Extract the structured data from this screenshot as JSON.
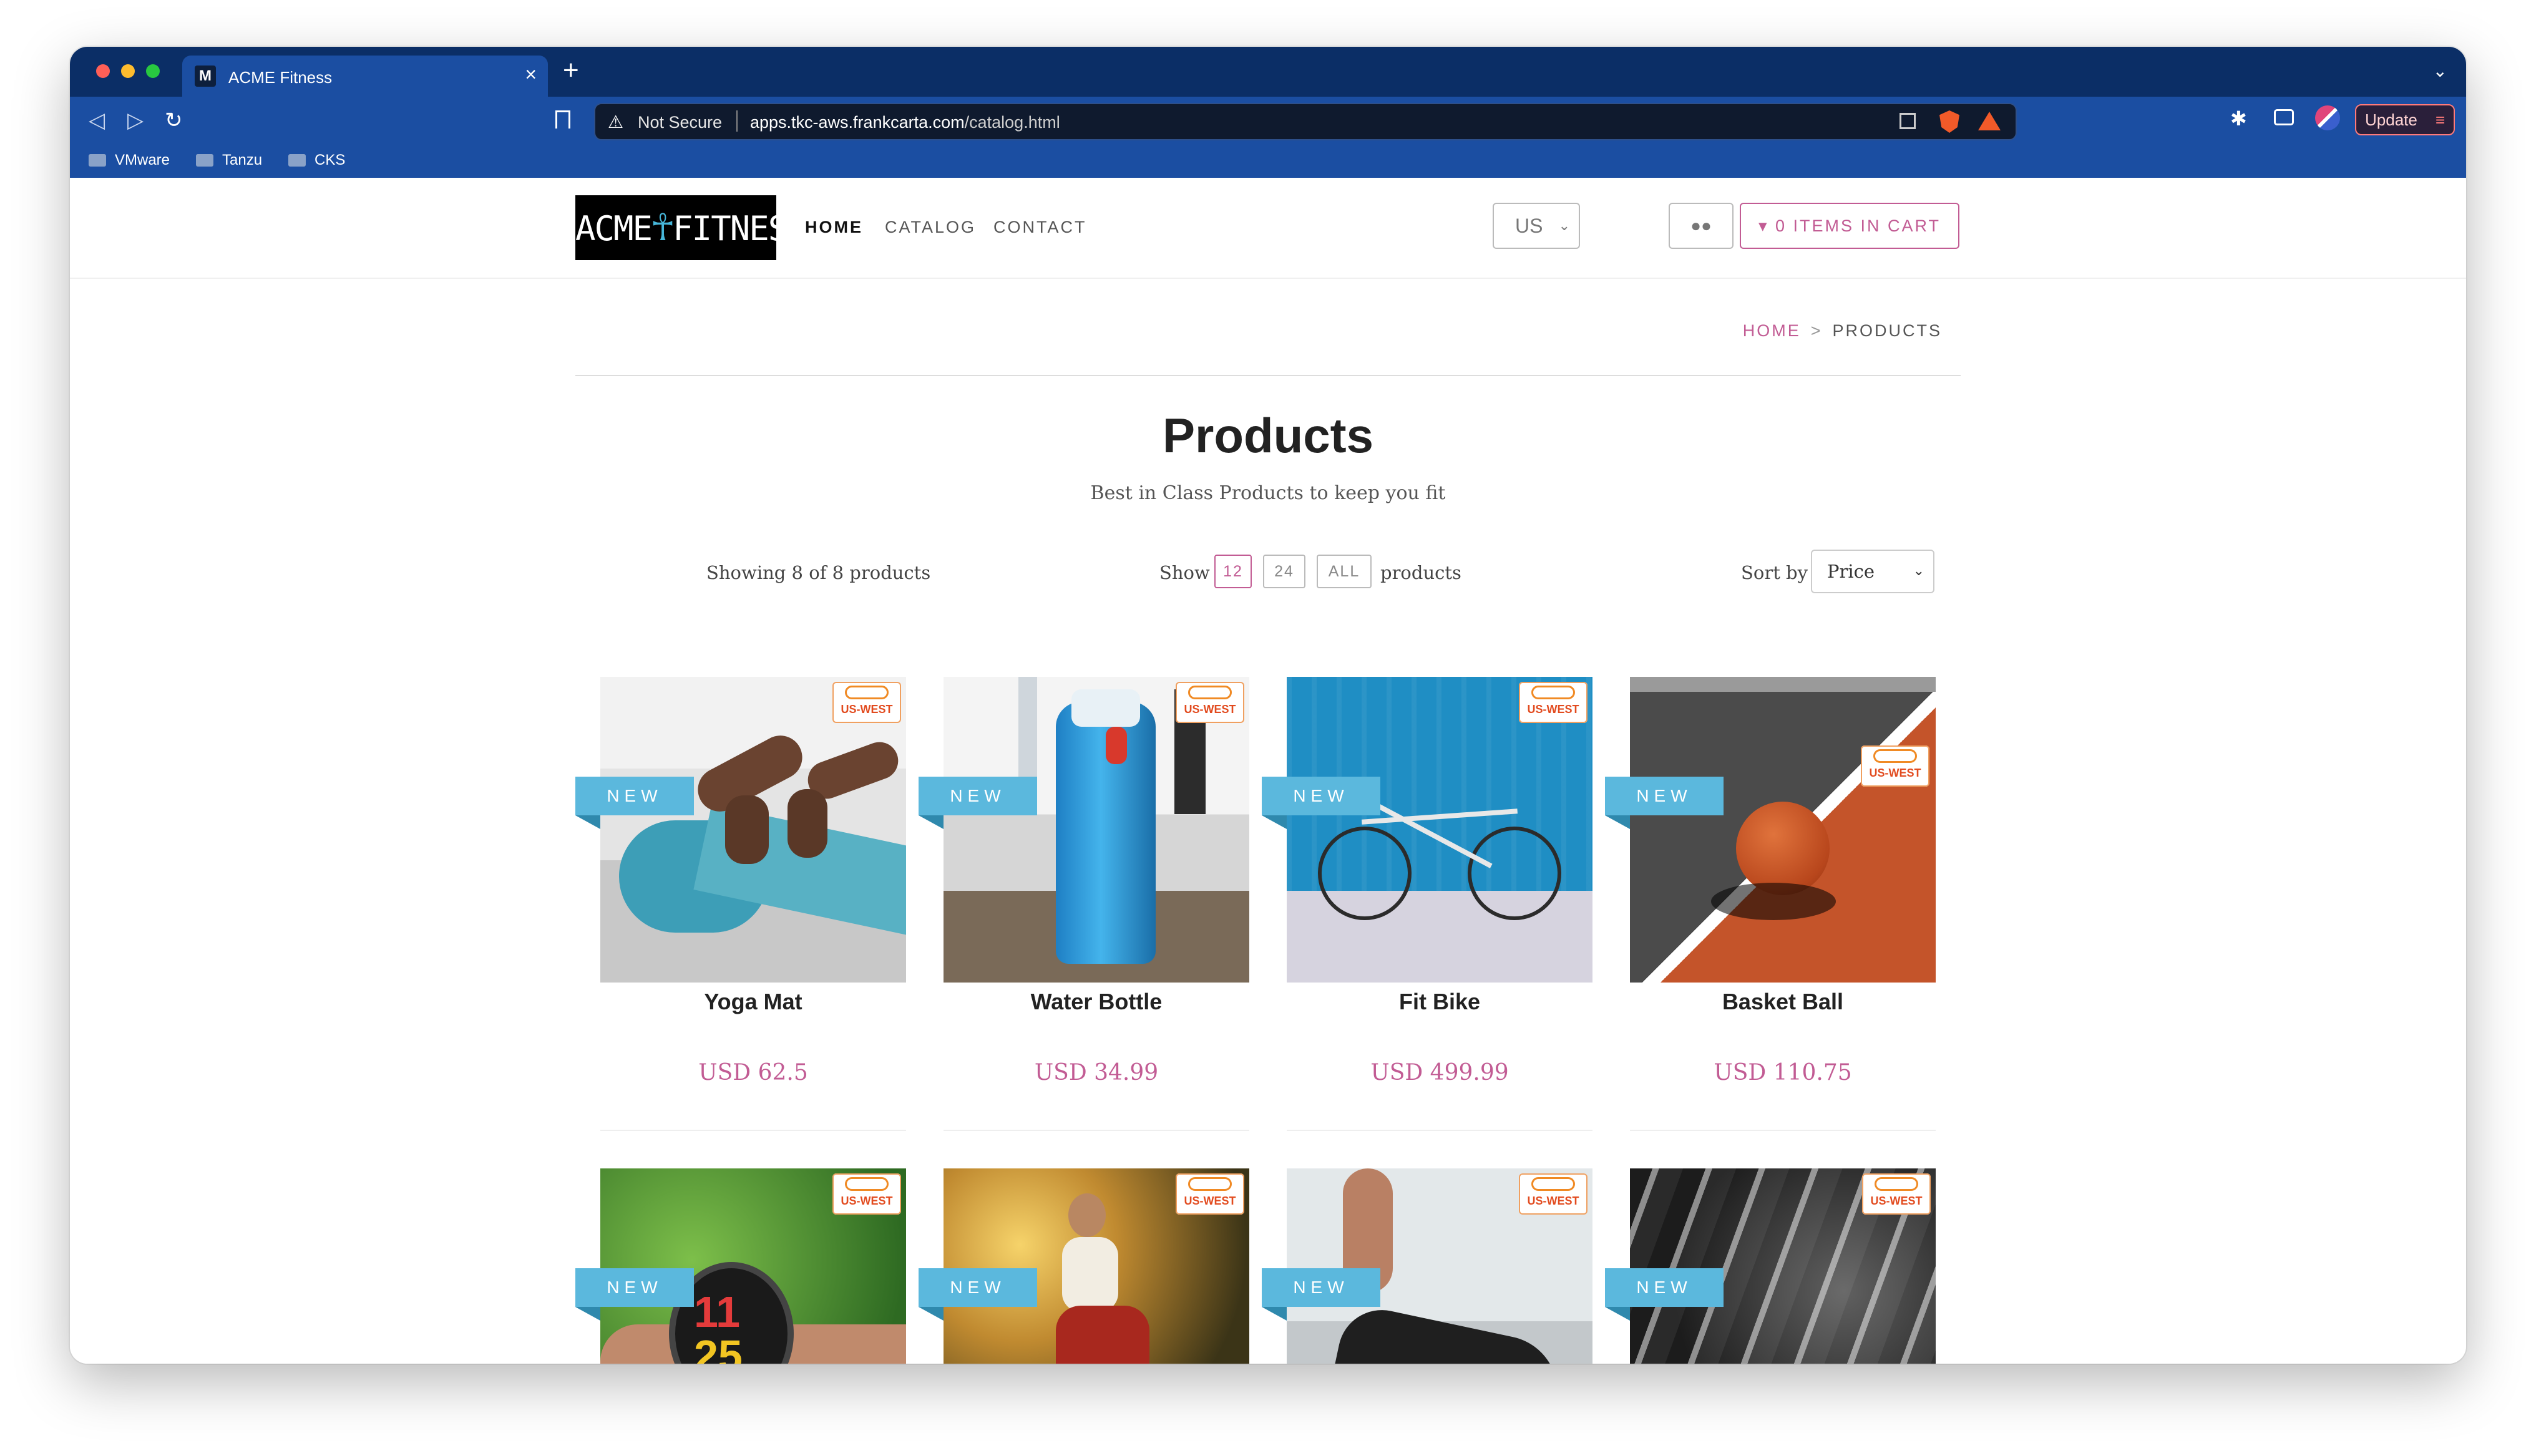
{
  "browser": {
    "tab_title": "ACME Fitness",
    "tab_favicon": "M",
    "new_tab_icon": "+",
    "security_label": "Not Secure",
    "url_host": "apps.tkc-aws.frankcarta.com",
    "url_path": "/catalog.html",
    "update_label": "Update",
    "bookmarks": [
      "VMware",
      "Tanzu",
      "CKS"
    ]
  },
  "site": {
    "logo_left": "ACME",
    "logo_runner": "☥",
    "logo_right": "FITNESS",
    "nav": [
      "HOME",
      "CATALOG",
      "CONTACT"
    ],
    "region": "US",
    "cart_label": "0 ITEMS IN CART"
  },
  "breadcrumb": {
    "home": "HOME",
    "sep": ">",
    "current": "PRODUCTS"
  },
  "page": {
    "title": "Products",
    "subtitle": "Best in Class Products to keep you fit",
    "showing": "Showing 8 of 8 products",
    "show_label": "Show",
    "page_sizes": [
      "12",
      "24",
      "ALL"
    ],
    "products_label": "products",
    "sort_label": "Sort by",
    "sort_value": "Price"
  },
  "products": [
    {
      "name": "Yoga Mat",
      "price": "USD 62.5",
      "badge": "NEW",
      "region_badge": "US-WEST"
    },
    {
      "name": "Water Bottle",
      "price": "USD 34.99",
      "badge": "NEW",
      "region_badge": "US-WEST"
    },
    {
      "name": "Fit Bike",
      "price": "USD 499.99",
      "badge": "NEW",
      "region_badge": "US-WEST"
    },
    {
      "name": "Basket Ball",
      "price": "USD 110.75",
      "badge": "NEW",
      "region_badge": "US-WEST"
    },
    {
      "name": "",
      "price": "",
      "badge": "NEW",
      "region_badge": "US-WEST"
    },
    {
      "name": "",
      "price": "",
      "badge": "NEW",
      "region_badge": "US-WEST"
    },
    {
      "name": "",
      "price": "",
      "badge": "NEW",
      "region_badge": "US-WEST"
    },
    {
      "name": "",
      "price": "",
      "badge": "NEW",
      "region_badge": "US-WEST"
    }
  ],
  "colors": {
    "chrome": "#1b4ea2",
    "accent": "#c25c94",
    "ribbon": "#5bb8dd"
  }
}
